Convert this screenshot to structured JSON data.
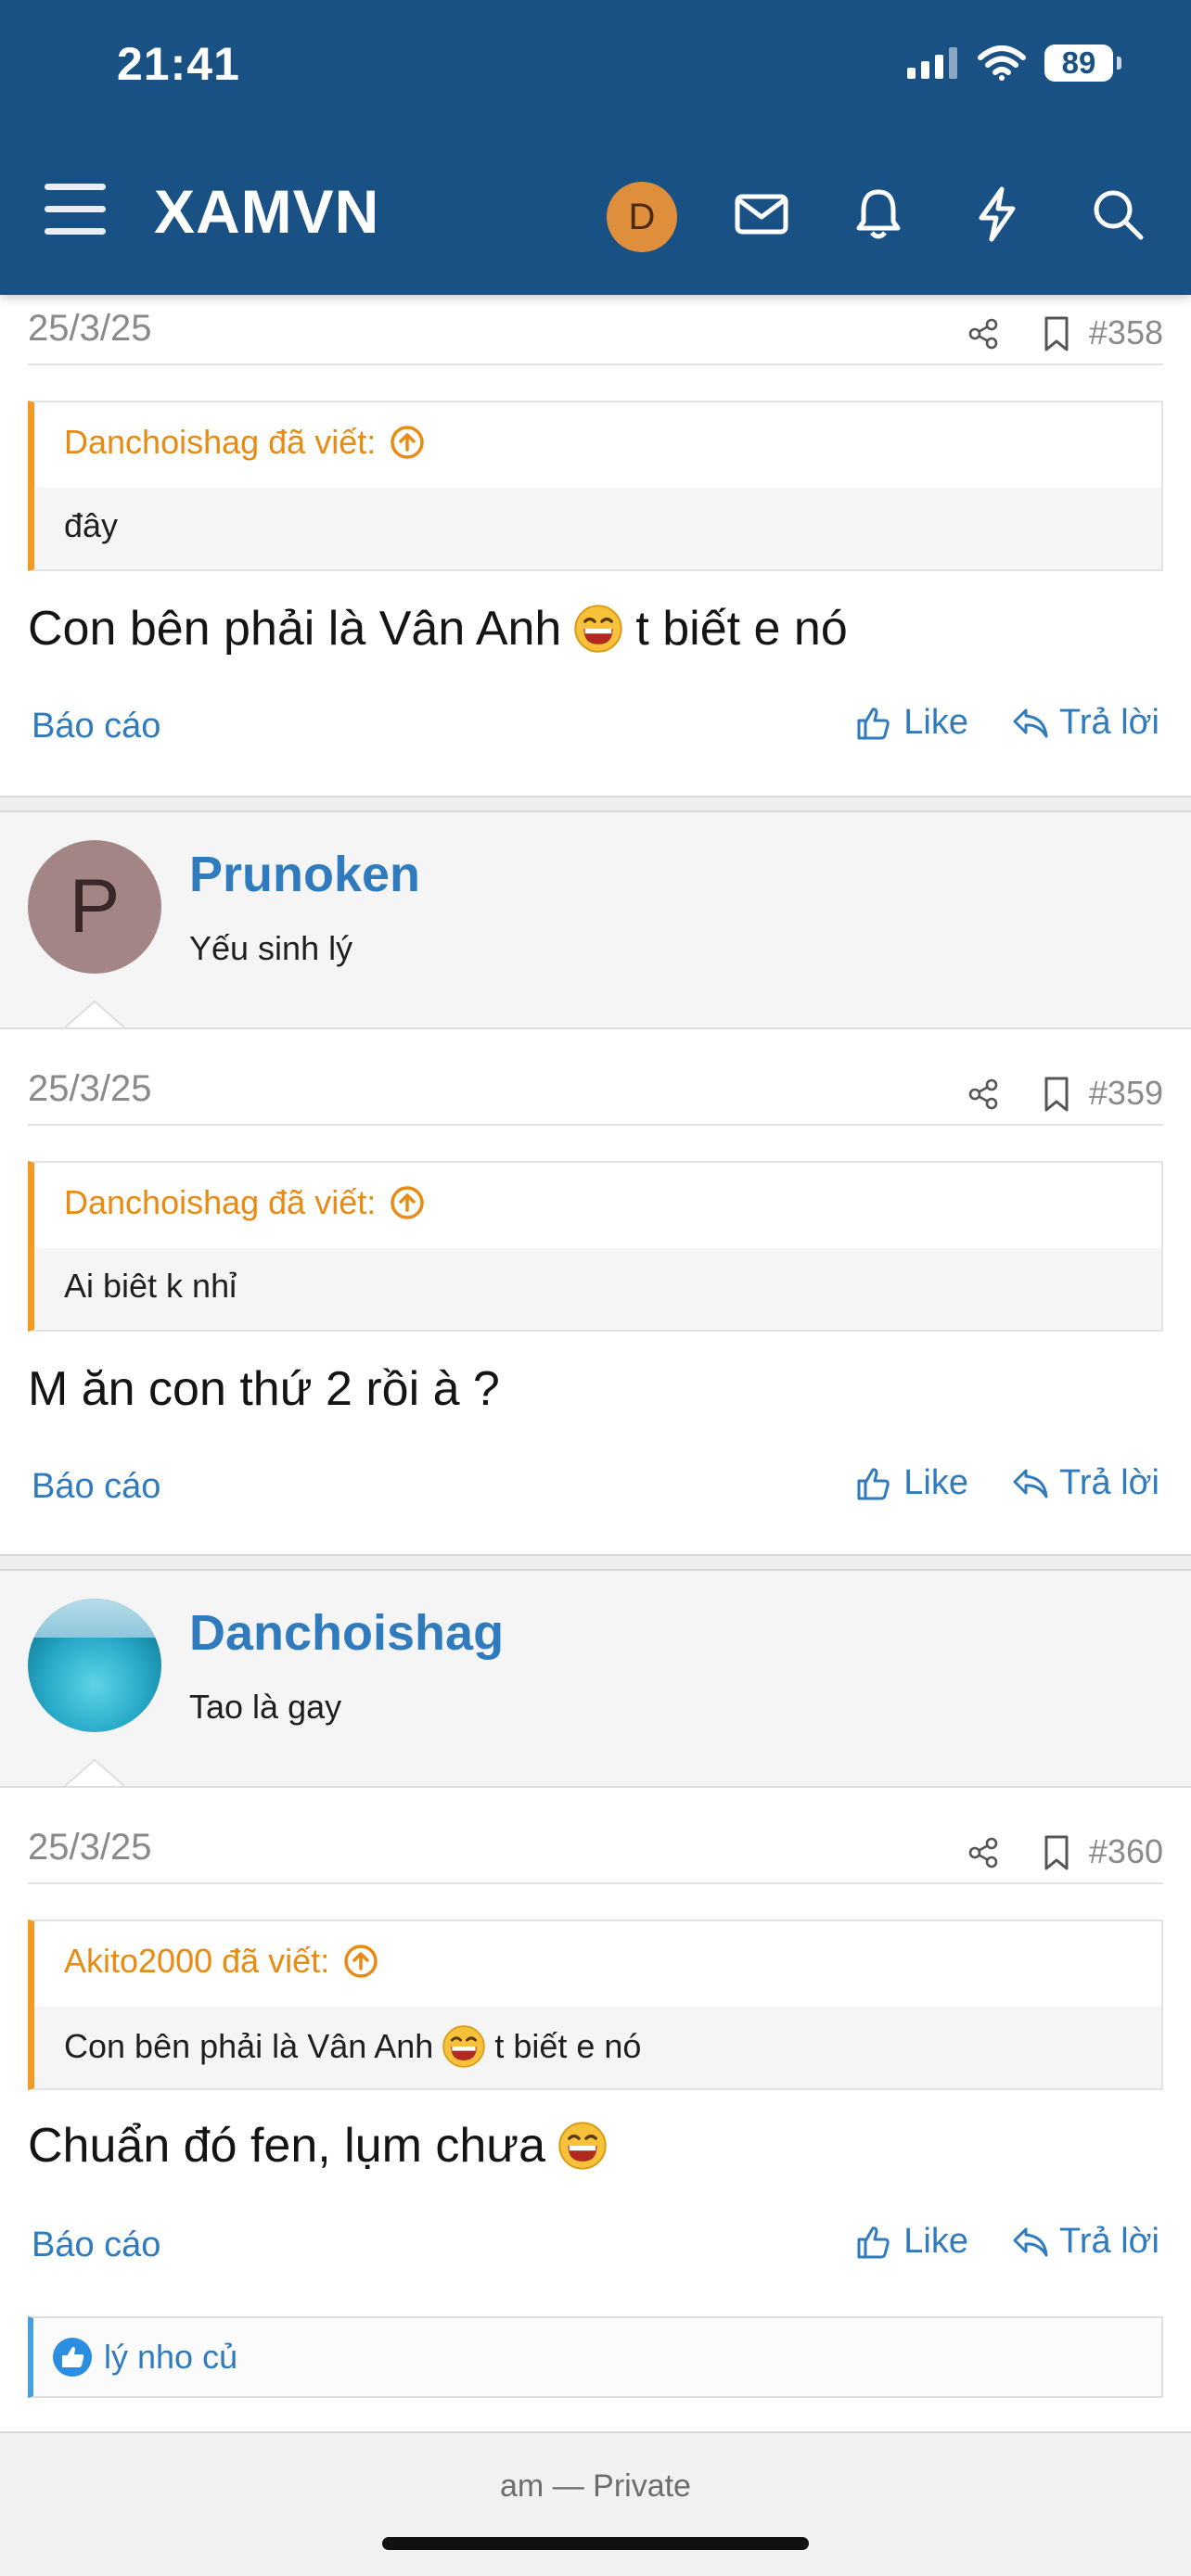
{
  "status_bar": {
    "time": "21:41",
    "battery": "89"
  },
  "header": {
    "logo": "XAMVN",
    "avatar_letter": "D",
    "icons": [
      "menu-icon",
      "mail-icon",
      "bell-icon",
      "bolt-icon",
      "search-icon"
    ]
  },
  "posts": [
    {
      "date": "25/3/25",
      "number": "#358",
      "quote_author": "Danchoishag đã viết:",
      "quote_text": "đây",
      "message_before": "Con bên phải là Vân Anh",
      "message_after": "t biết e nó",
      "report": "Báo cáo",
      "like": "Like",
      "reply": "Trả lời"
    },
    {
      "username": "Prunoken",
      "avatar_letter": "P",
      "user_title": "Yếu sinh lý",
      "date": "25/3/25",
      "number": "#359",
      "quote_author": "Danchoishag đã viết:",
      "quote_text": "Ai biêt k nhỉ",
      "message": "M ăn con thứ 2 rồi à ?",
      "report": "Báo cáo",
      "like": "Like",
      "reply": "Trả lời"
    },
    {
      "username": "Danchoishag",
      "user_title": "Tao là gay",
      "date": "25/3/25",
      "number": "#360",
      "quote_author": "Akito2000 đã viết:",
      "quote_text_before": "Con bên phải là Vân Anh",
      "quote_text_after": "t biết e nó",
      "message": "Chuẩn đó fen, lụm chưa",
      "report": "Báo cáo",
      "like": "Like",
      "reply": "Trả lời",
      "likes_by": "lý nho củ"
    }
  ],
  "bottom": {
    "text": "am — Private"
  },
  "colors": {
    "header": "#1a5185",
    "link": "#2f7bbd",
    "quote_accent": "#f29a22"
  }
}
